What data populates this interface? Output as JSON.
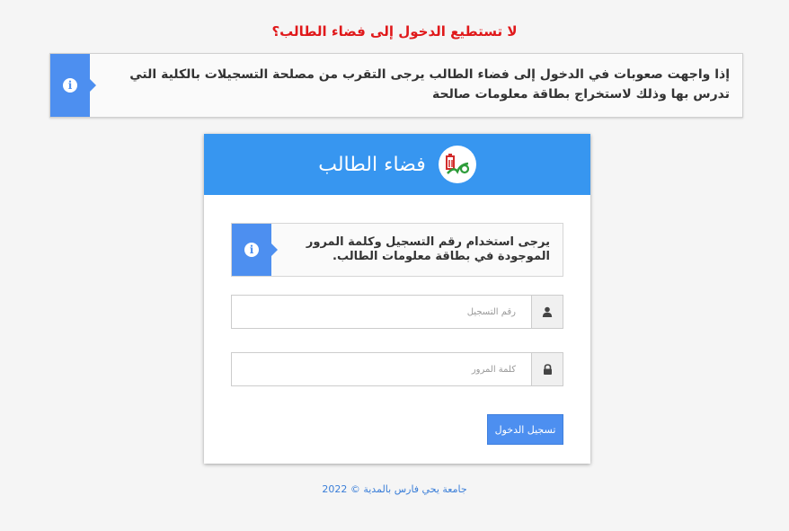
{
  "top_warning": "لا تستطيع الدخول إلى فضاء الطالب؟",
  "banner": {
    "icon": "info-icon",
    "text": "إذا واجهت صعوبات في الدخول إلى فضاء الطالب يرجى التقرب من مصلحة التسجيلات بالكلية التي تدرس بها وذلك لاستخراج بطاقة معلومات صالحة"
  },
  "card": {
    "header_title": "فضاء الطالب",
    "logo_icon": "university-logo-icon",
    "notice_icon": "info-icon",
    "notice_text": "يرجى استخدام رقم التسجيل وكلمة المرور الموجودة في بطاقة معلومات الطالب.",
    "registration_field": {
      "placeholder": "رقم التسجيل",
      "value": "",
      "icon": "user-icon"
    },
    "password_field": {
      "placeholder": "كلمة المرور",
      "value": "",
      "icon": "lock-icon"
    },
    "submit_label": "تسجيل الدخول"
  },
  "footer": "جامعة يحي فارس بالمدية © 2022",
  "colors": {
    "accent": "#3796f0",
    "info_box": "#4d8ff0",
    "warning_red": "#e0191b",
    "footer_link": "#3a7ed8"
  }
}
